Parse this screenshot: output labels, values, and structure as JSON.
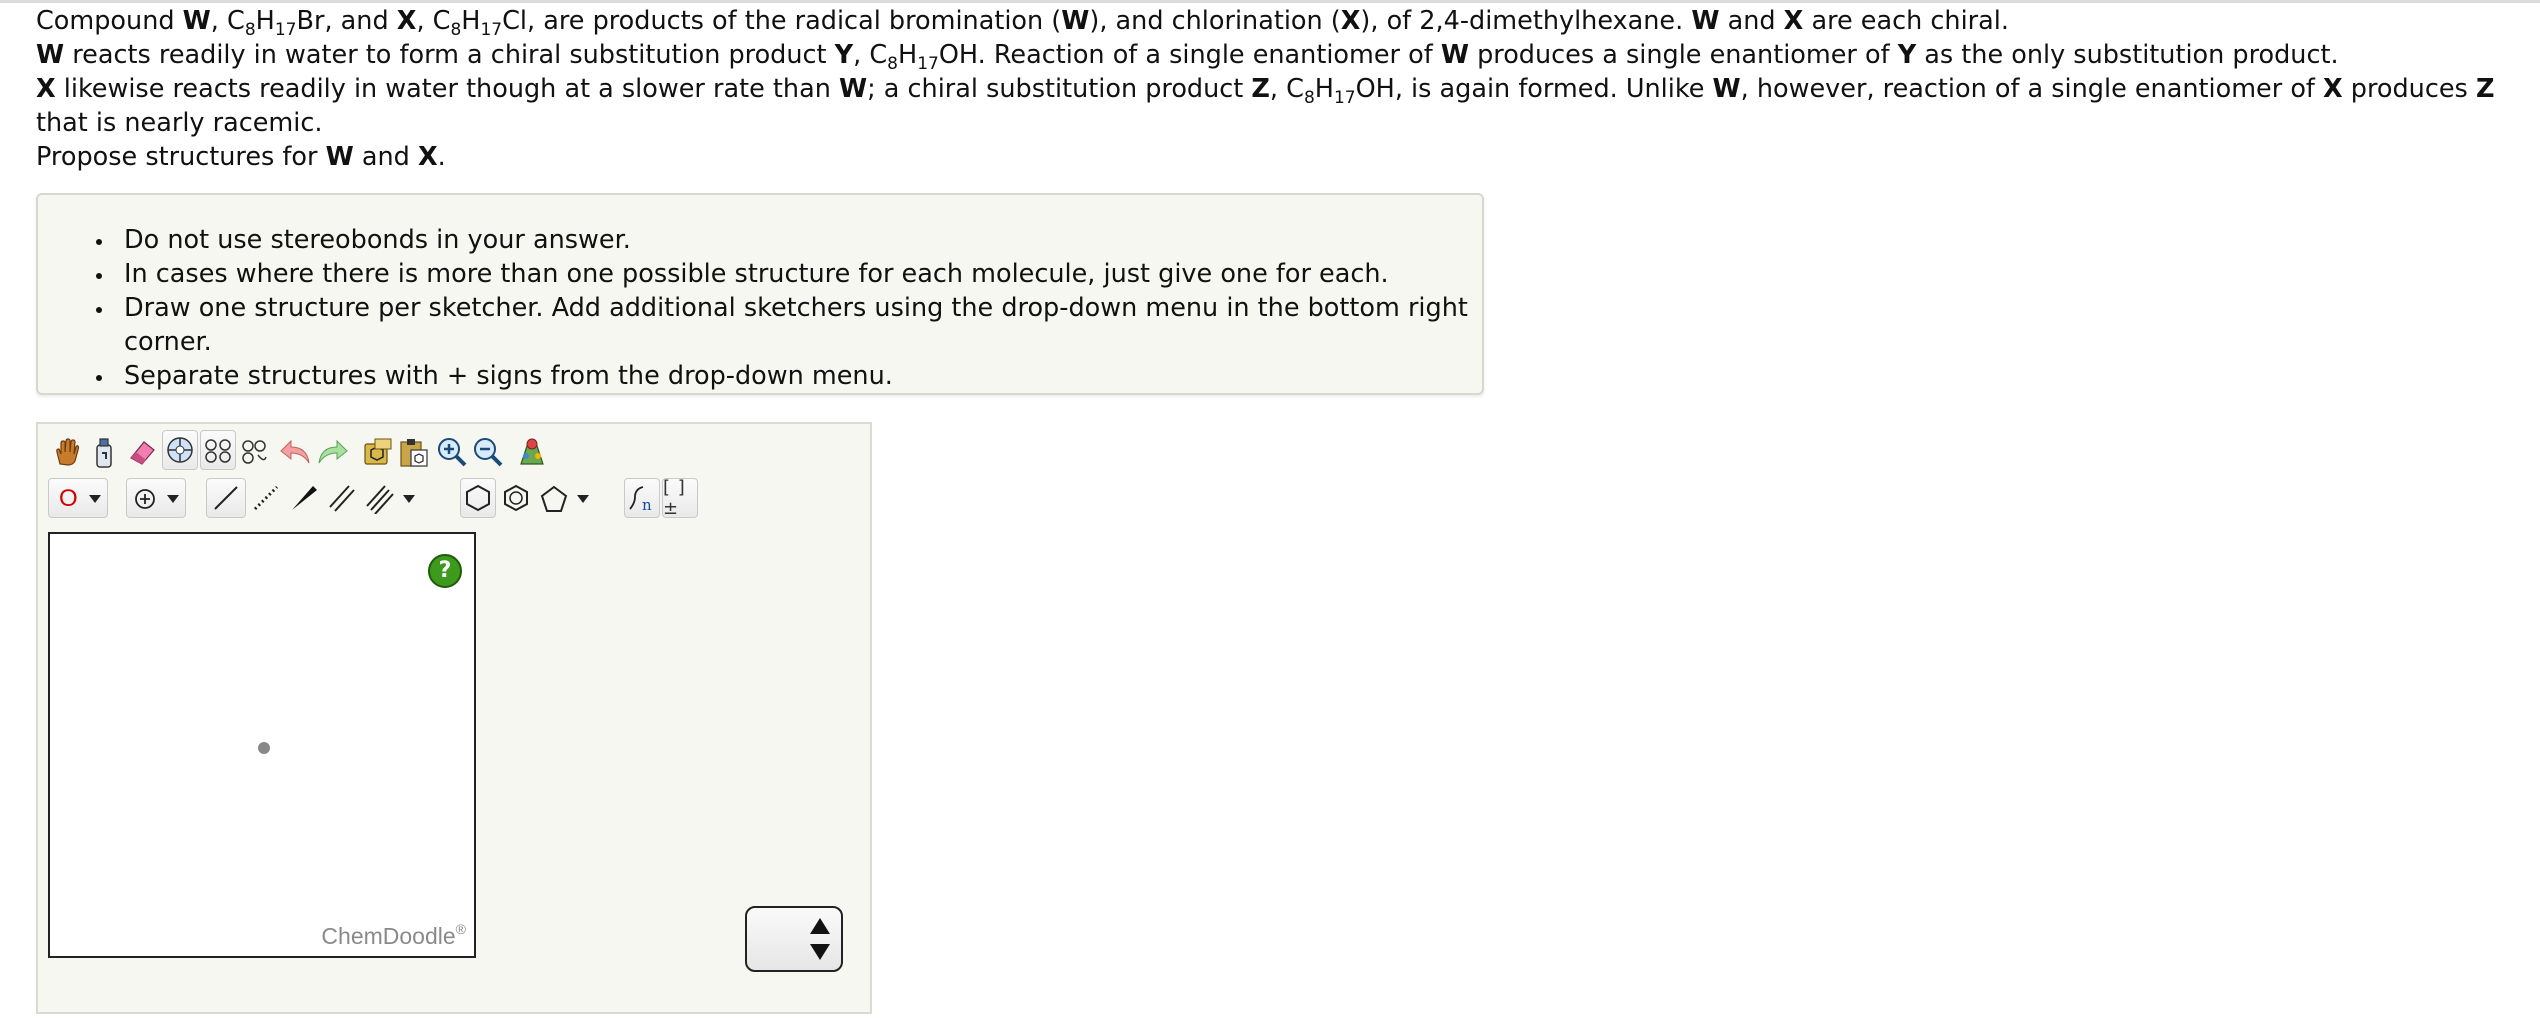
{
  "question": {
    "line1": {
      "t1": "Compound ",
      "W": "W",
      "t2": ", C",
      "s1": "8",
      "t3": "H",
      "s2": "17",
      "t4": "Br, and ",
      "X": "X",
      "t5": ", C",
      "s3": "8",
      "t6": "H",
      "s4": "17",
      "t7": "Cl, are products of the radical bromination (",
      "W2": "W",
      "t8": "), and chlorination (",
      "X2": "X",
      "t9": "), of 2,4-dimethylhexane. ",
      "W3": "W",
      "t10": " and ",
      "X3": "X",
      "t11": " are each chiral."
    },
    "line2": {
      "W": "W",
      "t1": " reacts readily in water to form a chiral substitution product ",
      "Y": "Y",
      "t2": ", C",
      "s1": "8",
      "t3": "H",
      "s2": "17",
      "t4": "OH. Reaction of a single enantiomer of ",
      "W2": "W",
      "t5": " produces a single enantiomer of ",
      "Y2": "Y",
      "t6": " as the only substitution product."
    },
    "line3": {
      "X": "X",
      "t1": " likewise reacts readily in water though at a slower rate than ",
      "W": "W",
      "t2": "; a chiral substitution product ",
      "Z": "Z",
      "t3": ", C",
      "s1": "8",
      "t4": "H",
      "s2": "17",
      "t5": "OH, is again formed. Unlike ",
      "W2": "W",
      "t6": ", however, reaction of a single enantiomer of ",
      "X2": "X",
      "t7": " produces ",
      "Z2": "Z",
      "t8": " that is nearly racemic."
    },
    "line4": {
      "t1": "Propose structures for ",
      "W": "W",
      "t2": " and ",
      "X": "X",
      "t3": "."
    }
  },
  "notes": [
    "Do not use stereobonds in your answer.",
    "In cases where there is more than one possible structure for each molecule, just give one for each.",
    "Draw one structure per sketcher. Add additional sketchers using the drop-down menu in the bottom right corner.",
    "Separate structures with + signs from the drop-down menu."
  ],
  "sketcher": {
    "element_label": "O",
    "help_label": "?",
    "brand": "ChemDoodle",
    "brand_mark": "®",
    "bracket_label": "[ ]±",
    "n_label": "n"
  },
  "colors": {
    "element_red": "#d40000",
    "help_green": "#3e9a1c",
    "panel_bg": "#f7f7f2"
  },
  "icons": [
    "hand-pan-icon",
    "clear-bottle-icon",
    "eraser-icon",
    "center-molecule-icon",
    "flip-horizontal-icon",
    "flip-vertical-icon",
    "undo-icon",
    "redo-icon",
    "templates-icon",
    "paste-icon",
    "zoom-in-icon",
    "zoom-out-icon",
    "clean-icon",
    "charge-plus-icon",
    "single-bond-icon",
    "dashed-bond-icon",
    "wedge-bond-icon",
    "double-bond-icon",
    "triple-bond-icon",
    "cyclohexane-icon",
    "benzene-icon",
    "cyclopentane-icon",
    "repeat-unit-icon",
    "bracket-charge-icon"
  ]
}
